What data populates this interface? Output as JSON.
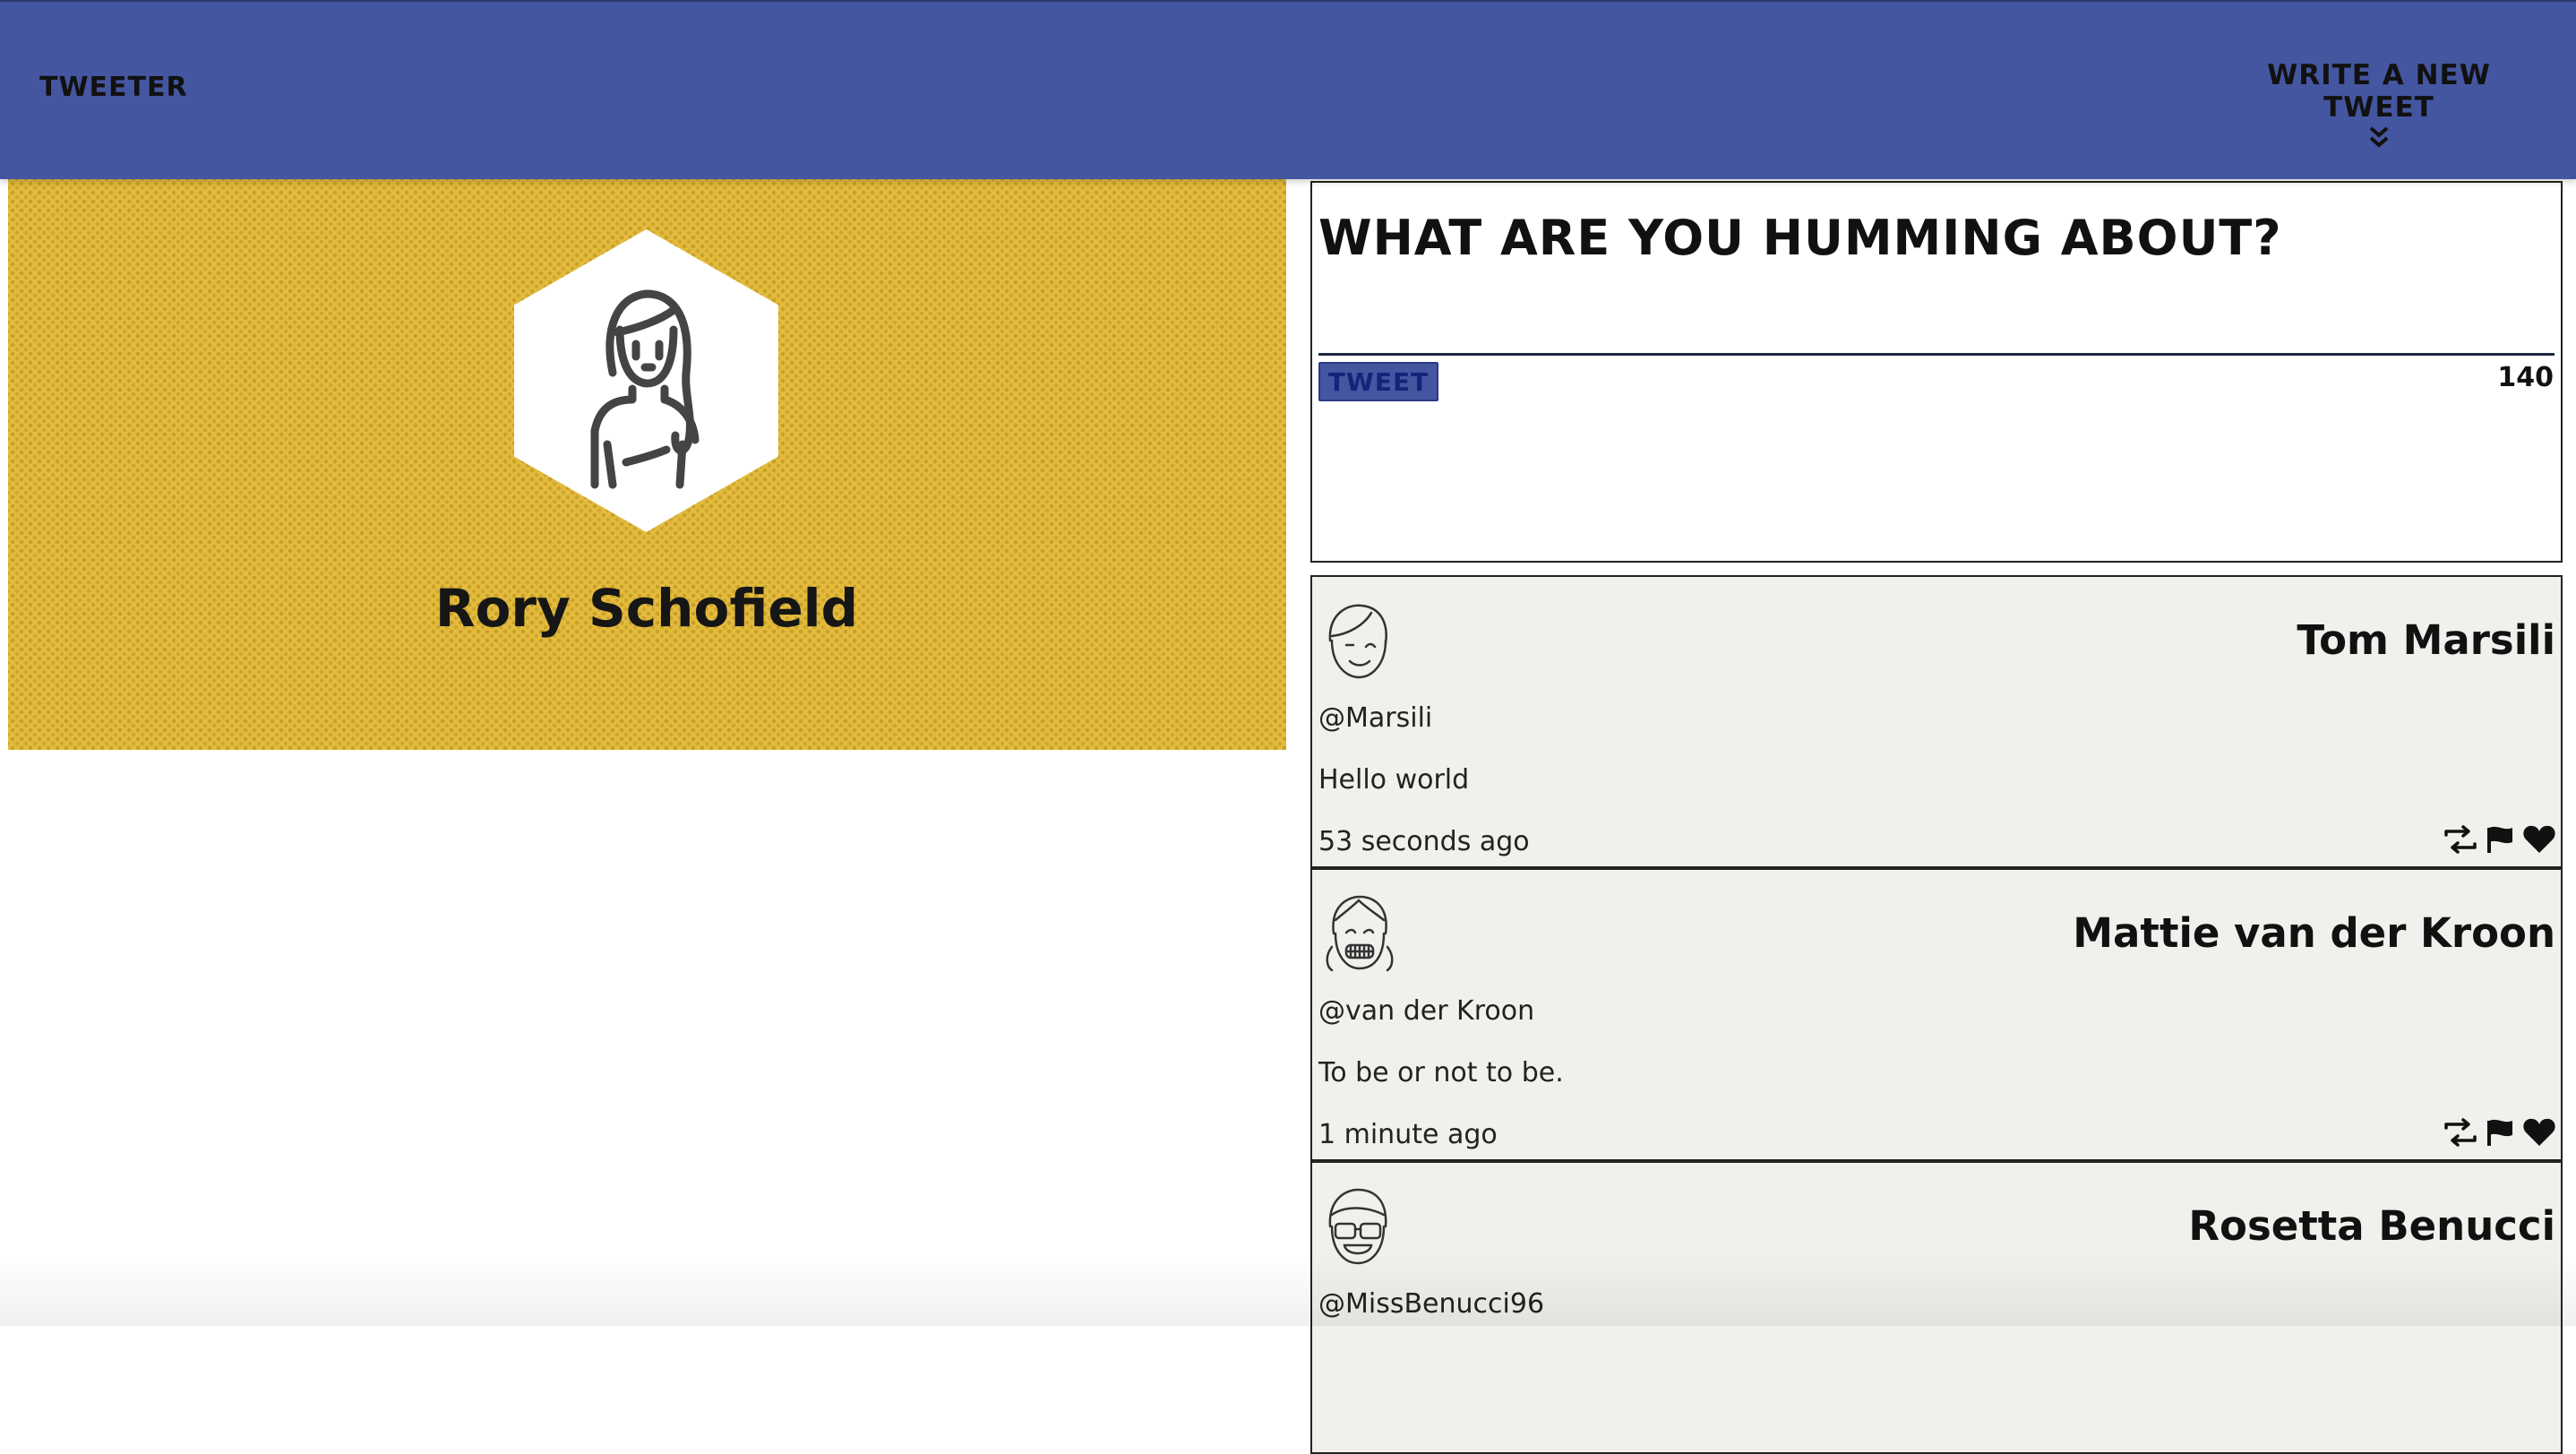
{
  "nav": {
    "brand": "Tweeter",
    "compose_label": "Write a new tweet"
  },
  "profile": {
    "name": "Rory Schofield",
    "avatar_icon": "woman-avatar-icon"
  },
  "composer": {
    "prompt": "What are you humming about?",
    "button_label": "Tweet",
    "counter": "140"
  },
  "tweets": [
    {
      "name": "Tom Marsili",
      "handle": "@Marsili",
      "text": "Hello world",
      "time": "53 seconds ago",
      "avatar_icon": "winking-man-avatar-icon"
    },
    {
      "name": "Mattie van der Kroon",
      "handle": "@van der Kroon",
      "text": "To be or not to be.",
      "time": "1 minute ago",
      "avatar_icon": "girl-with-braces-avatar-icon"
    },
    {
      "name": "Rosetta Benucci",
      "handle": "@MissBenucci96",
      "text": "",
      "time": "",
      "avatar_icon": "glasses-avatar-icon"
    }
  ],
  "colors": {
    "nav_bg": "#4556a0",
    "profile_bg": "#e3bb3d",
    "tweet_bg": "#f1f0ec"
  }
}
